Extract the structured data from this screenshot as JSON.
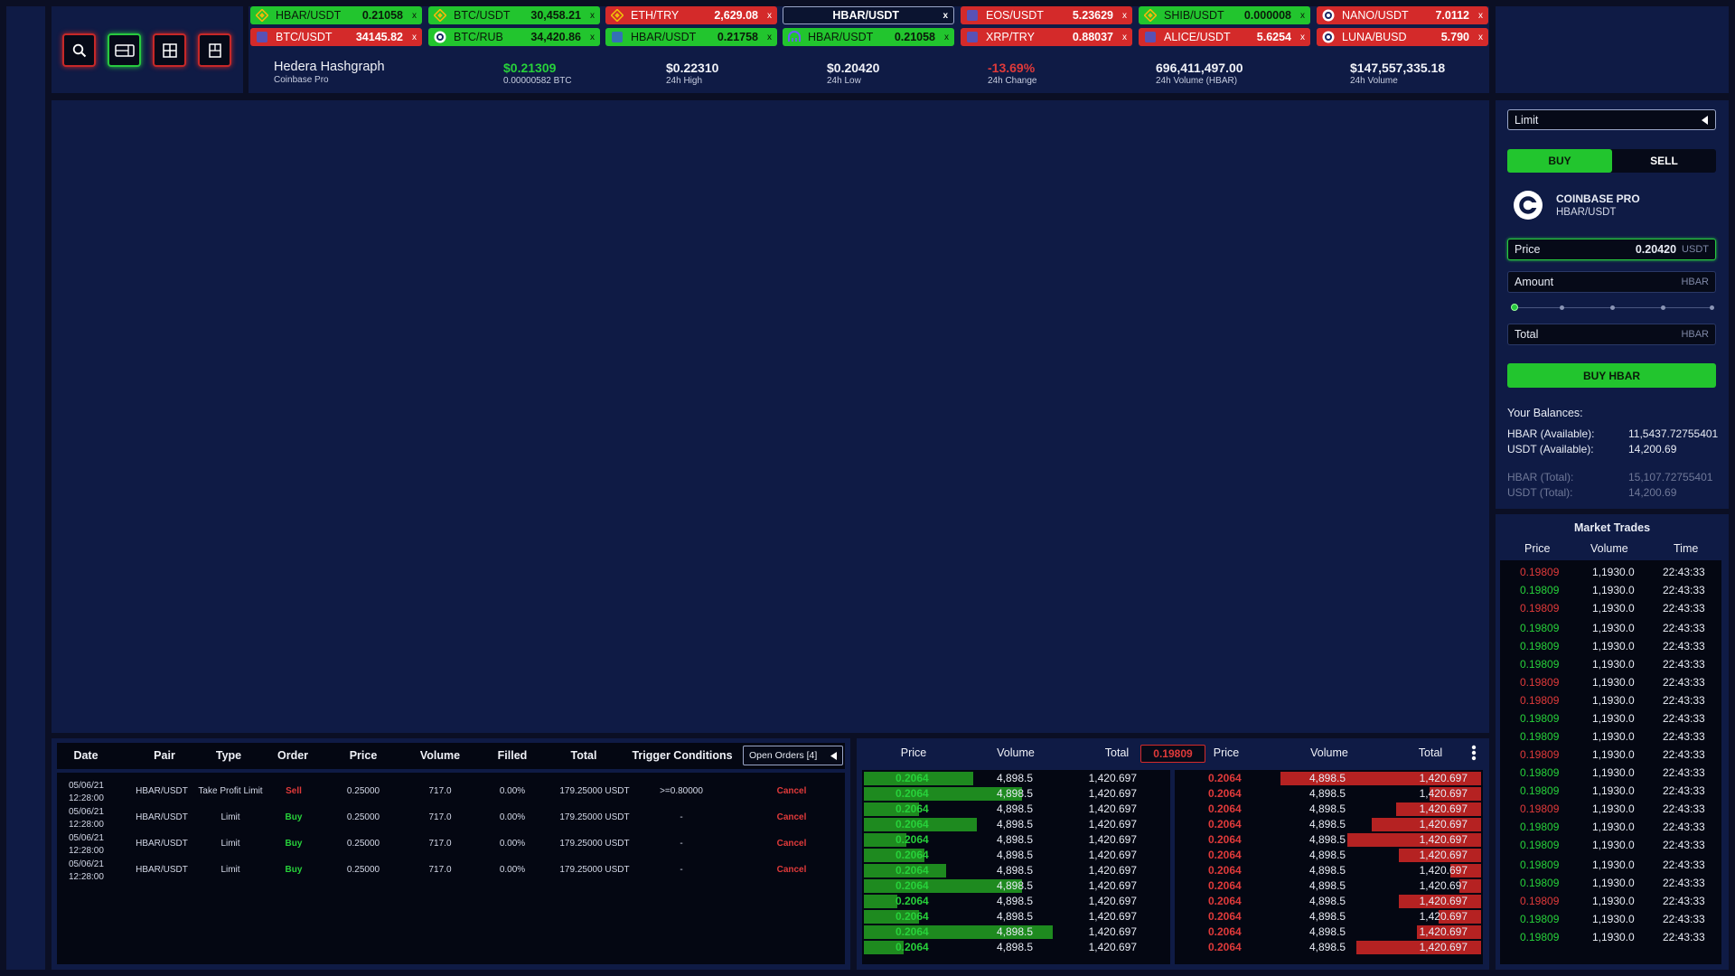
{
  "toolbar": {
    "buttons": [
      "search-icon",
      "layout-icon",
      "grid-icon",
      "panel-icon"
    ]
  },
  "tickers": [
    {
      "pair": "HBAR/USDT",
      "value": "0.21058",
      "color": "green",
      "icon": "binance"
    },
    {
      "pair": "BTC/USDT",
      "value": "30,458.21",
      "color": "green",
      "icon": "binance"
    },
    {
      "pair": "ETH/TRY",
      "value": "2,629.08",
      "color": "red",
      "icon": "binance"
    },
    {
      "pair": "HBAR/USDT",
      "value": "",
      "color": "dark",
      "icon": ""
    },
    {
      "pair": "EOS/USDT",
      "value": "5.23629",
      "color": "red",
      "icon": "coin"
    },
    {
      "pair": "SHIB/USDT",
      "value": "0.000008",
      "color": "green",
      "icon": "binance"
    },
    {
      "pair": "NANO/USDT",
      "value": "7.0112",
      "color": "red",
      "icon": "coinbase"
    },
    {
      "pair": "BTC/USDT",
      "value": "34145.82",
      "color": "red",
      "icon": "coin"
    },
    {
      "pair": "BTC/RUB",
      "value": "34,420.86",
      "color": "green",
      "icon": "coinbase"
    },
    {
      "pair": "HBAR/USDT",
      "value": "0.21758",
      "color": "green",
      "icon": "coin"
    },
    {
      "pair": "HBAR/USDT",
      "value": "0.21058",
      "color": "green",
      "icon": "kraken"
    },
    {
      "pair": "XRP/TRY",
      "value": "0.88037",
      "color": "red",
      "icon": "coin"
    },
    {
      "pair": "ALICE/USDT",
      "value": "5.6254",
      "color": "red",
      "icon": "coin"
    },
    {
      "pair": "LUNA/BUSD",
      "value": "5.790",
      "color": "red",
      "icon": "coinbase"
    }
  ],
  "ticker_close": "x",
  "asset": {
    "name": "Hedera Hashgraph",
    "exchange": "Coinbase Pro"
  },
  "stats": [
    {
      "big": "$0.21309",
      "small": "0.00000582 BTC",
      "color": "#27d13a"
    },
    {
      "big": "$0.22310",
      "small": "24h High",
      "color": "#f0f2f8"
    },
    {
      "big": "$0.20420",
      "small": "24h Low",
      "color": "#f0f2f8"
    },
    {
      "big": "-13.69%",
      "small": "24h Change",
      "color": "#e03a3a"
    },
    {
      "big": "696,411,497.00",
      "small": "24h Volume (HBAR)",
      "color": "#f0f2f8"
    },
    {
      "big": "$147,557,335.18",
      "small": "24h Volume",
      "color": "#f0f2f8"
    }
  ],
  "order_form": {
    "order_type": "Limit",
    "buy_label": "BUY",
    "sell_label": "SELL",
    "exchange_name": "COINBASE PRO",
    "exchange_pair": "HBAR/USDT",
    "price_label": "Price",
    "price_value": "0.20420",
    "price_unit": "USDT",
    "amount_label": "Amount",
    "amount_unit": "HBAR",
    "slider_value": 0,
    "total_label": "Total",
    "total_unit": "HBAR",
    "submit_label": "BUY HBAR",
    "balances_title": "Your Balances:",
    "balances": [
      {
        "label": "HBAR (Available):",
        "value": "11,5437.72755401",
        "dim": false
      },
      {
        "label": "USDT (Available):",
        "value": "14,200.69",
        "dim": false
      },
      {
        "label": "HBAR (Total):",
        "value": "15,107.72755401",
        "dim": true
      },
      {
        "label": "USDT (Total):",
        "value": "14,200.69",
        "dim": true
      }
    ]
  },
  "market_trades": {
    "title": "Market Trades",
    "headers": [
      "Price",
      "Volume",
      "Time"
    ],
    "volume": "1,1930.0",
    "time": "22:43:33",
    "price": "0.19809",
    "sides": [
      "red",
      "green",
      "red",
      "green",
      "green",
      "green",
      "red",
      "red",
      "green",
      "green",
      "red",
      "green",
      "green",
      "red",
      "green",
      "green",
      "green",
      "green",
      "red",
      "green",
      "green"
    ]
  },
  "open_orders": {
    "headers": [
      "Date",
      "Pair",
      "Type",
      "Order",
      "Price",
      "Volume",
      "Filled",
      "Total",
      "Trigger Conditions"
    ],
    "dropdown": "Open Orders [4]",
    "rows": [
      {
        "date": "05/06/21",
        "time": "12:28:00",
        "pair": "HBAR/USDT",
        "type": "Take Profit Limit",
        "order": "Sell",
        "price": "0.25000",
        "volume": "717.0",
        "filled": "0.00%",
        "total": "179.25000 USDT",
        "trigger": ">=0.80000",
        "action": "Cancel"
      },
      {
        "date": "05/06/21",
        "time": "12:28:00",
        "pair": "HBAR/USDT",
        "type": "Limit",
        "order": "Buy",
        "price": "0.25000",
        "volume": "717.0",
        "filled": "0.00%",
        "total": "179.25000 USDT",
        "trigger": "-",
        "action": "Cancel"
      },
      {
        "date": "05/06/21",
        "time": "12:28:00",
        "pair": "HBAR/USDT",
        "type": "Limit",
        "order": "Buy",
        "price": "0.25000",
        "volume": "717.0",
        "filled": "0.00%",
        "total": "179.25000 USDT",
        "trigger": "-",
        "action": "Cancel"
      },
      {
        "date": "05/06/21",
        "time": "12:28:00",
        "pair": "HBAR/USDT",
        "type": "Limit",
        "order": "Buy",
        "price": "0.25000",
        "volume": "717.0",
        "filled": "0.00%",
        "total": "179.25000 USDT",
        "trigger": "-",
        "action": "Cancel"
      }
    ]
  },
  "order_book": {
    "headers": [
      "Price",
      "Volume",
      "Total"
    ],
    "spread_price": "0.19809",
    "row": {
      "price": "0.2064",
      "volume": "4,898.5",
      "total": "1,420.697"
    },
    "bid_depths": [
      0.36,
      0.52,
      0.18,
      0.37,
      0.14,
      0.2,
      0.27,
      0.52,
      0.11,
      0.18,
      0.62,
      0.13
    ],
    "ask_depths": [
      0.66,
      0.17,
      0.28,
      0.36,
      0.44,
      0.27,
      0.1,
      0.07,
      0.27,
      0.14,
      0.21,
      0.41
    ]
  },
  "colors": {
    "green": "#22c52e",
    "red": "#d42a2a",
    "panel": "#0f1b45",
    "dark": "#040712"
  }
}
